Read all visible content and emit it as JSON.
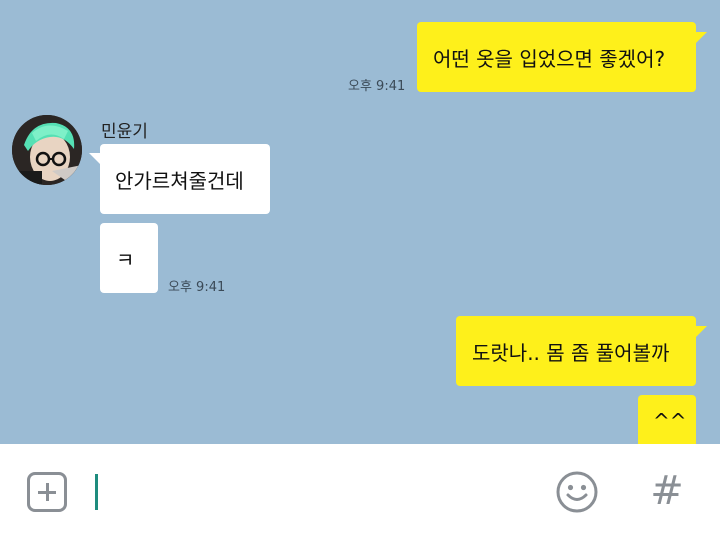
{
  "messages": {
    "m1": {
      "text": "어떤 옷을 입었으면 좋겠어?",
      "time": "오후 9:41"
    },
    "sender_name": "민윤기",
    "m2": {
      "text": "안가르쳐줄건데"
    },
    "m3": {
      "text": "ㅋ",
      "time": "오후 9:41"
    },
    "m4": {
      "text": "도랏나.. 몸 좀 풀어볼까"
    },
    "m5": {
      "text": "^^"
    }
  },
  "input_bar": {
    "attach_icon": "plus-square-icon",
    "emoji_icon": "smiley-icon",
    "hash_label": "#"
  },
  "colors": {
    "chat_background": "#9bbbd4",
    "my_bubble": "#fef01b",
    "their_bubble": "#ffffff",
    "cursor": "#1e8c7e"
  }
}
